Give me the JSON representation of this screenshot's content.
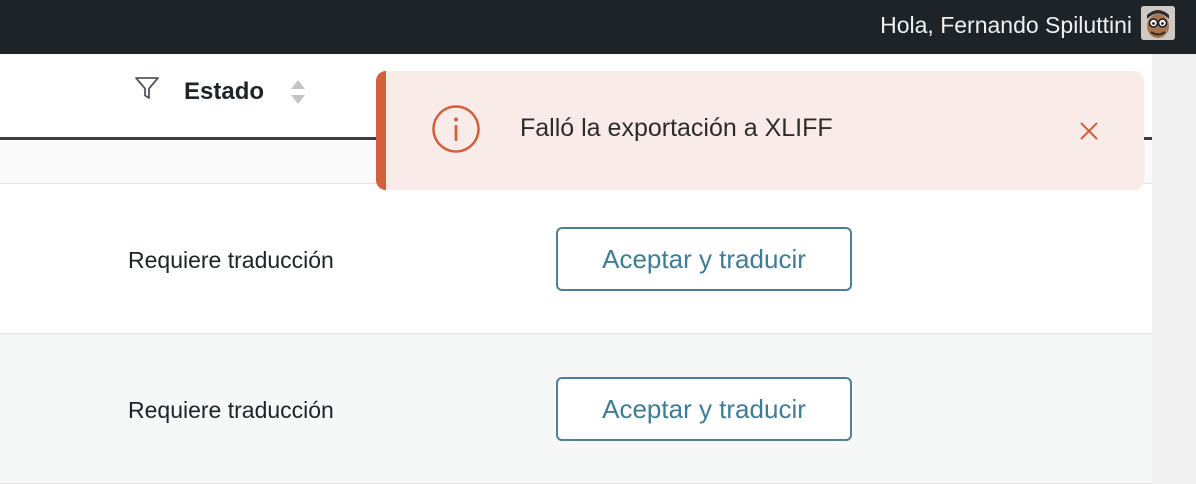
{
  "admin_bar": {
    "greeting": "Hola, Fernando Spiluttini",
    "avatar_icon": "user-avatar"
  },
  "table": {
    "header": {
      "filter_icon": "filter-funnel-icon",
      "column_title": "Estado",
      "sort_icon": "sort-arrows-icon"
    },
    "rows": [
      {
        "status": "Requiere traducción",
        "action_label": "Aceptar y traducir"
      },
      {
        "status": "Requiere traducción",
        "action_label": "Aceptar y traducir"
      }
    ]
  },
  "notification": {
    "type": "error",
    "icon": "info-circle-icon",
    "message": "Falló la exportación a XLIFF",
    "close_icon": "close-icon"
  },
  "colors": {
    "admin_bar_bg": "#1d2327",
    "toast_bg": "#f9ece8",
    "toast_accent": "#d35f3c",
    "button_text": "#3f7d94"
  }
}
